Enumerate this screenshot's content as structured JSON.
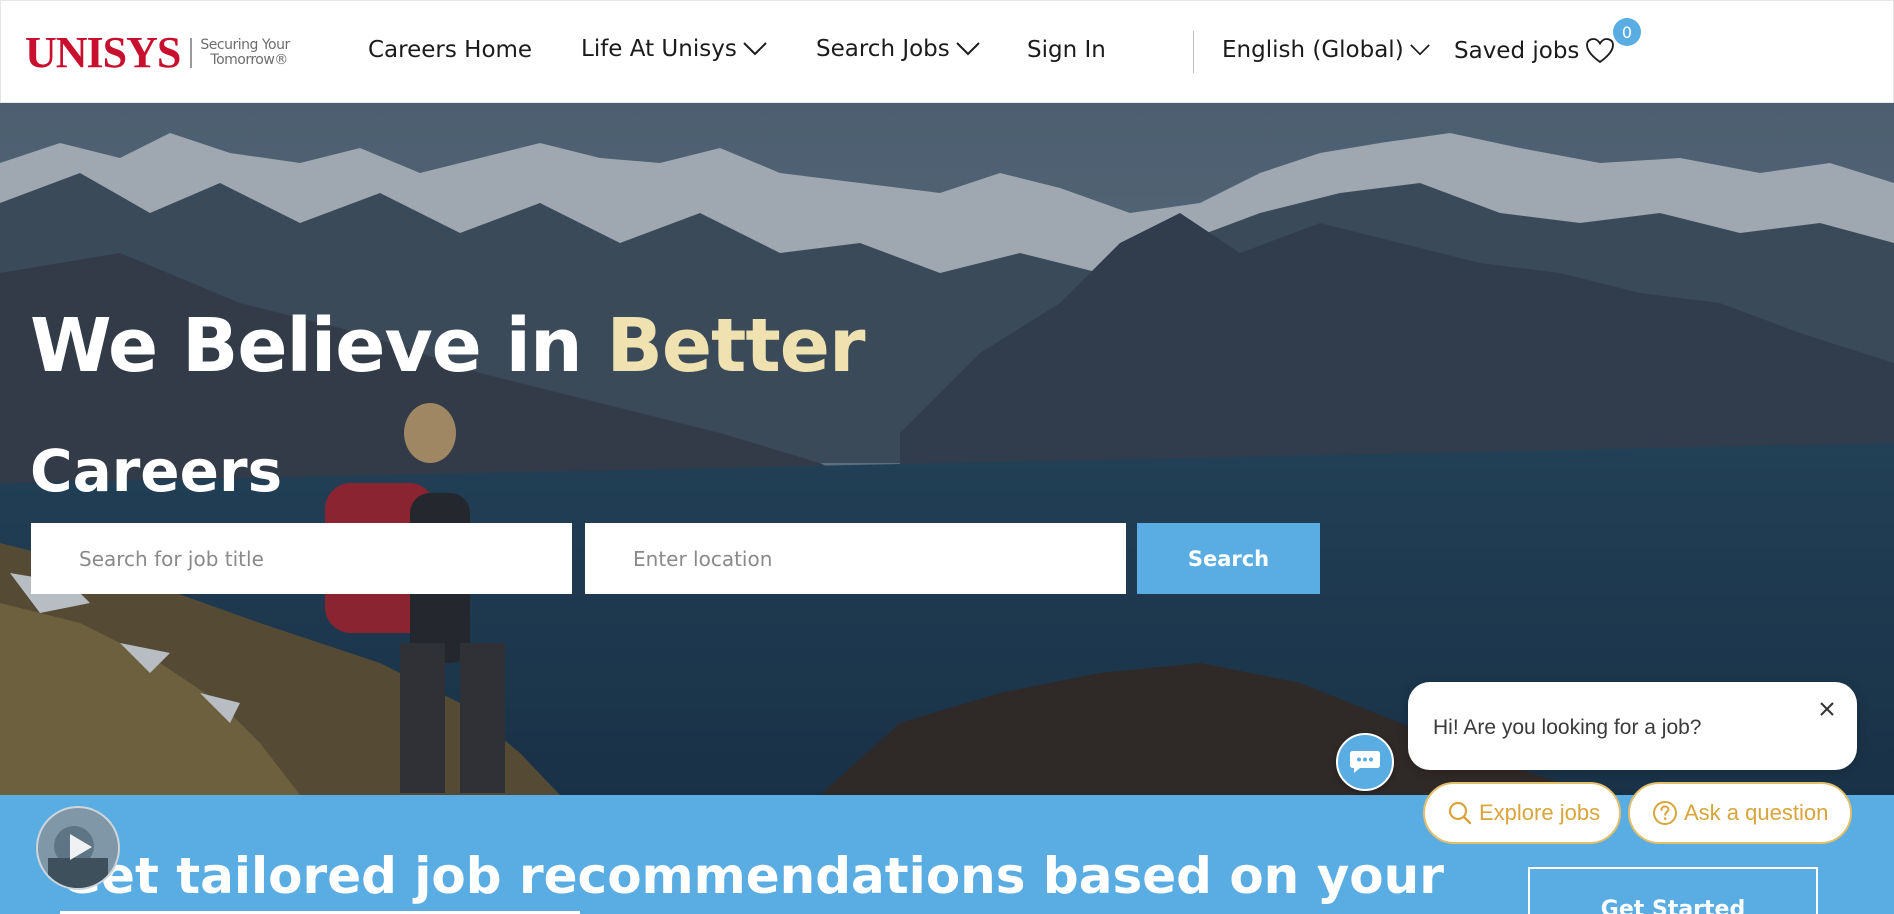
{
  "brand": {
    "name": "UNISYS",
    "tagline_line1": "Securing Your",
    "tagline_line2": "Tomorrow®"
  },
  "nav": {
    "careers_home": "Careers Home",
    "life_at_unisys": "Life At Unisys",
    "search_jobs": "Search Jobs",
    "sign_in": "Sign In",
    "language": "English (Global)",
    "saved_jobs": "Saved jobs",
    "saved_count": "0"
  },
  "hero": {
    "title_main": "We Believe in ",
    "title_accent": "Better",
    "subtitle": "Careers",
    "job_placeholder": "Search for job title",
    "location_placeholder": "Enter location",
    "search_button": "Search"
  },
  "band": {
    "text": "Get tailored job recommendations based on your",
    "button": "Get Started"
  },
  "chat": {
    "message": "Hi! Are you looking for a job?",
    "explore_label": "Explore jobs",
    "ask_label": "Ask a question"
  },
  "colors": {
    "brand_red": "#c8102e",
    "accent_blue": "#5aade2",
    "accent_cream": "#efe2b0",
    "chat_gold": "#d9a53b"
  },
  "icons": {
    "chevron": "chevron-down-icon",
    "heart": "heart-icon",
    "close": "close-icon",
    "chat": "chat-icon",
    "search": "search-icon",
    "question": "question-icon",
    "play": "play-icon"
  }
}
